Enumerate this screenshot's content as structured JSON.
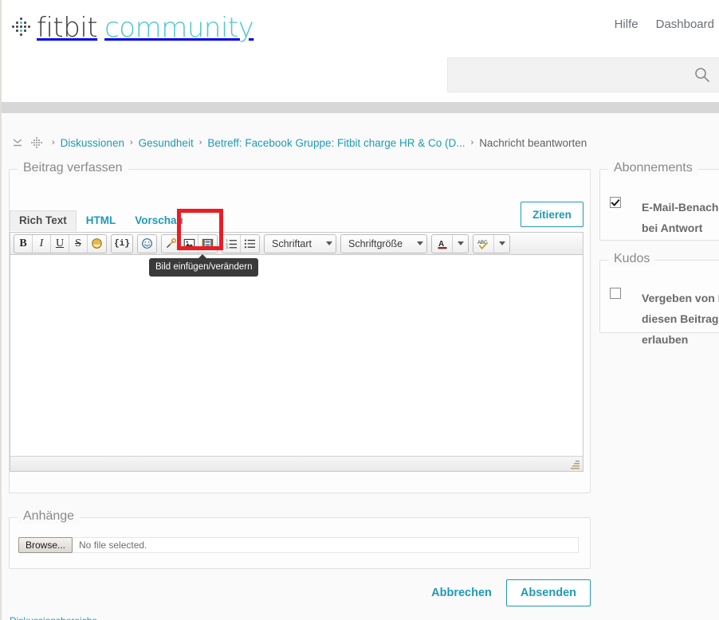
{
  "brand": {
    "name_part1": "fitbit",
    "name_part2": "community",
    "logo_icon": "fitbit-dots-logo",
    "teal": "#4ec7d3"
  },
  "header": {
    "nav": [
      {
        "label": "Hilfe",
        "name": "nav-hilfe"
      },
      {
        "label": "Dashboard",
        "name": "nav-dashboard"
      }
    ],
    "search": {
      "value": "",
      "placeholder": "",
      "icon": "search-icon"
    }
  },
  "breadcrumb": {
    "collapse_icon": "collapse-chevrons-icon",
    "home_icon": "fitbit-home-dots-icon",
    "separator": "›",
    "items": [
      {
        "label": "Diskussionen",
        "link": true
      },
      {
        "label": "Gesundheit",
        "link": true
      },
      {
        "label": "Betreff: Facebook Gruppe: Fitbit charge HR & Co (D...",
        "link": true
      },
      {
        "label": "Nachricht beantworten",
        "link": false
      }
    ]
  },
  "compose": {
    "legend": "Beitrag verfassen",
    "quote_button": "Zitieren",
    "tabs": [
      {
        "label": "Rich Text",
        "active": true
      },
      {
        "label": "HTML",
        "active": false
      },
      {
        "label": "Vorschau",
        "active": false
      }
    ],
    "editor_value": "",
    "toolbar": {
      "groups": [
        {
          "name": "text-format-group",
          "buttons": [
            {
              "name": "bold-icon",
              "glyph": "B",
              "label": "Fett"
            },
            {
              "name": "italic-icon",
              "glyph": "I",
              "label": "Kursiv"
            },
            {
              "name": "underline-icon",
              "glyph": "U",
              "label": "Unterstrichen"
            },
            {
              "name": "strikethrough-icon",
              "glyph": "S",
              "label": "Durchgestrichen"
            },
            {
              "name": "highlight-icon",
              "glyph": "◕",
              "label": "Hervorheben"
            }
          ]
        },
        {
          "name": "insert-code-group",
          "buttons": [
            {
              "name": "insert-code-icon",
              "glyph": "{i}",
              "label": "Code einfügen"
            }
          ]
        },
        {
          "name": "emoticon-group",
          "buttons": [
            {
              "name": "smiley-icon",
              "glyph": "☺",
              "label": "Smiley einfügen"
            }
          ]
        },
        {
          "name": "insert-media-group",
          "buttons": [
            {
              "name": "insert-link-icon",
              "glyph": "🔗",
              "label": "Link einfügen"
            },
            {
              "name": "insert-image-icon",
              "glyph": "⛰",
              "label": "Bild einfügen/verändern"
            },
            {
              "name": "insert-video-icon",
              "glyph": "🎞",
              "label": "Video einfügen"
            }
          ]
        },
        {
          "name": "list-group",
          "buttons": [
            {
              "name": "ordered-list-icon",
              "glyph": "☰",
              "label": "Nummerierte Liste"
            },
            {
              "name": "unordered-list-icon",
              "glyph": "☰",
              "label": "Aufzählung"
            }
          ]
        }
      ],
      "font_family_label": "Schriftart",
      "font_size_label": "Schriftgröße",
      "text_color_icon": "text-color-icon",
      "text_color_glyph": "A",
      "spellcheck_icon": "spellcheck-abc-icon",
      "spellcheck_glyph": "ABC"
    }
  },
  "tooltip": {
    "text": "Bild einfügen/verändern"
  },
  "highlight": {
    "color": "#ec1c24",
    "target": "insert-image-icon"
  },
  "sidebar": {
    "subscriptions": {
      "legend": "Abonnements",
      "checkbox_checked": true,
      "label": "E-Mail-Benachr\nbei Antwort",
      "label_line1": "E-Mail-Benachr",
      "label_line2": "bei Antwort"
    },
    "kudos": {
      "legend": "Kudos",
      "checkbox_checked": false,
      "label_line1": "Vergeben von K",
      "label_line2": "diesen Beitrag",
      "label_line3": "erlauben"
    }
  },
  "attachments": {
    "legend": "Anhänge",
    "browse_button": "Browse...",
    "file_status": "No file selected."
  },
  "actions": {
    "cancel": "Abbrechen",
    "submit": "Absenden"
  },
  "footer": {
    "cut_text": "Diskussionsbereiche"
  }
}
